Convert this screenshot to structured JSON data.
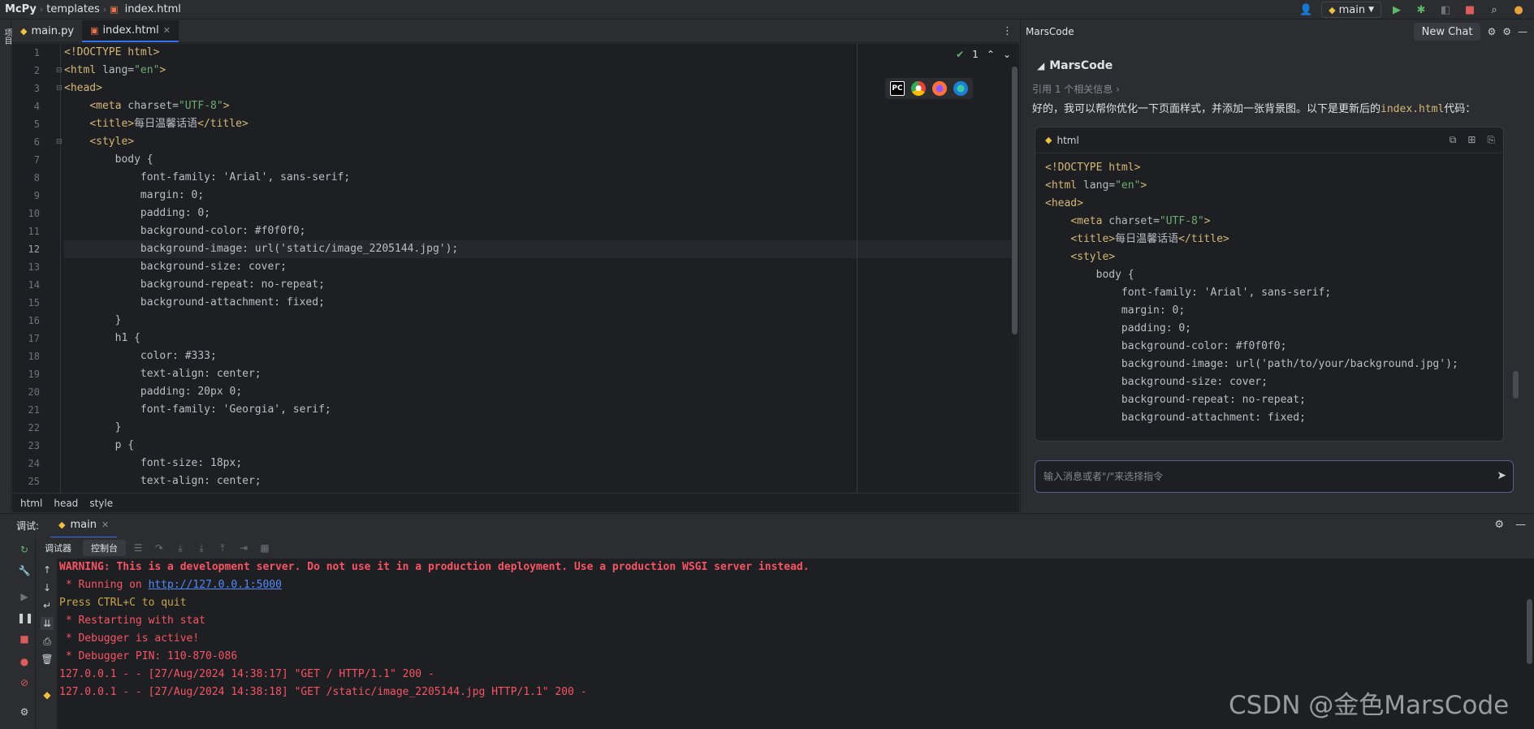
{
  "titlebar": {
    "project": "McPy",
    "folder": "templates",
    "file": "index.html",
    "branch": "main"
  },
  "left_stripe_label": "项目",
  "tabs": [
    {
      "label": "main.py",
      "icon": "python-file-icon"
    },
    {
      "label": "index.html",
      "icon": "html-file-icon"
    }
  ],
  "editor": {
    "current_line": 12,
    "inspection_count": "1",
    "lines": [
      [
        {
          "c": "tag",
          "t": "<!DOCTYPE "
        },
        {
          "c": "tag",
          "t": "html"
        },
        {
          "c": "tag",
          "t": ">"
        }
      ],
      [
        {
          "c": "tag",
          "t": "<html "
        },
        {
          "c": "attr",
          "t": "lang="
        },
        {
          "c": "str",
          "t": "\"en\""
        },
        {
          "c": "tag",
          "t": ">"
        }
      ],
      [
        {
          "c": "tag",
          "t": "<head>"
        }
      ],
      [
        {
          "c": "txt",
          "t": "    "
        },
        {
          "c": "tag",
          "t": "<meta "
        },
        {
          "c": "attr",
          "t": "charset="
        },
        {
          "c": "str",
          "t": "\"UTF-8\""
        },
        {
          "c": "tag",
          "t": ">"
        }
      ],
      [
        {
          "c": "txt",
          "t": "    "
        },
        {
          "c": "tag",
          "t": "<title>"
        },
        {
          "c": "txt",
          "t": "每日温馨话语"
        },
        {
          "c": "tag",
          "t": "</title>"
        }
      ],
      [
        {
          "c": "txt",
          "t": "    "
        },
        {
          "c": "tag",
          "t": "<style>"
        }
      ],
      [
        {
          "c": "sel",
          "t": "        body {"
        }
      ],
      [
        {
          "c": "prop",
          "t": "            font-family: 'Arial', sans-serif;"
        }
      ],
      [
        {
          "c": "prop",
          "t": "            margin: 0;"
        }
      ],
      [
        {
          "c": "prop",
          "t": "            padding: 0;"
        }
      ],
      [
        {
          "c": "prop",
          "t": "            background-color: #f0f0f0;"
        }
      ],
      [
        {
          "c": "prop",
          "t": "            background-image: url('static/image_2205144.jpg');"
        }
      ],
      [
        {
          "c": "prop",
          "t": "            background-size: cover;"
        }
      ],
      [
        {
          "c": "prop",
          "t": "            background-repeat: no-repeat;"
        }
      ],
      [
        {
          "c": "prop",
          "t": "            background-attachment: fixed;"
        }
      ],
      [
        {
          "c": "sel",
          "t": "        }"
        }
      ],
      [
        {
          "c": "sel",
          "t": "        h1 {"
        }
      ],
      [
        {
          "c": "prop",
          "t": "            color: #333;"
        }
      ],
      [
        {
          "c": "prop",
          "t": "            text-align: center;"
        }
      ],
      [
        {
          "c": "prop",
          "t": "            padding: 20px 0;"
        }
      ],
      [
        {
          "c": "prop",
          "t": "            font-family: 'Georgia', serif;"
        }
      ],
      [
        {
          "c": "sel",
          "t": "        }"
        }
      ],
      [
        {
          "c": "sel",
          "t": "        p {"
        }
      ],
      [
        {
          "c": "prop",
          "t": "            font-size: 18px;"
        }
      ],
      [
        {
          "c": "prop",
          "t": "            text-align: center;"
        }
      ]
    ]
  },
  "breadcrumbs": [
    "html",
    "head",
    "style"
  ],
  "marscode": {
    "panel_title": "MarsCode",
    "new_chat": "New Chat",
    "assistant_name": "MarsCode",
    "reference": "引用 1 个相关信息 ›",
    "message_prefix": "好的，我可以帮你优化一下页面样式，并添加一张背景图。以下是更新后的",
    "message_file": "index.html",
    "message_suffix": "代码：",
    "code_lang": "html",
    "code_lines": [
      [
        {
          "c": "tag",
          "t": "<!DOCTYPE html>"
        }
      ],
      [
        {
          "c": "tag",
          "t": "<html "
        },
        {
          "c": "attr",
          "t": "lang="
        },
        {
          "c": "str",
          "t": "\"en\""
        },
        {
          "c": "tag",
          "t": ">"
        }
      ],
      [
        {
          "c": "tag",
          "t": "<head>"
        }
      ],
      [
        {
          "c": "txt",
          "t": "    "
        },
        {
          "c": "tag",
          "t": "<meta "
        },
        {
          "c": "attr",
          "t": "charset="
        },
        {
          "c": "str",
          "t": "\"UTF-8\""
        },
        {
          "c": "tag",
          "t": ">"
        }
      ],
      [
        {
          "c": "txt",
          "t": "    "
        },
        {
          "c": "tag",
          "t": "<title>"
        },
        {
          "c": "txt",
          "t": "每日温馨话语"
        },
        {
          "c": "tag",
          "t": "</title>"
        }
      ],
      [
        {
          "c": "txt",
          "t": "    "
        },
        {
          "c": "tag",
          "t": "<style>"
        }
      ],
      [
        {
          "c": "sel",
          "t": "        body {"
        }
      ],
      [
        {
          "c": "prop",
          "t": "            font-family: 'Arial', sans-serif;"
        }
      ],
      [
        {
          "c": "prop",
          "t": "            margin: 0;"
        }
      ],
      [
        {
          "c": "prop",
          "t": "            padding: 0;"
        }
      ],
      [
        {
          "c": "prop",
          "t": "            background-color: #f0f0f0;"
        }
      ],
      [
        {
          "c": "prop",
          "t": "            background-image: url('path/to/your/background.jpg');"
        }
      ],
      [
        {
          "c": "prop",
          "t": "            background-size: cover;"
        }
      ],
      [
        {
          "c": "prop",
          "t": "            background-repeat: no-repeat;"
        }
      ],
      [
        {
          "c": "prop",
          "t": "            background-attachment: fixed;"
        }
      ]
    ],
    "input_placeholder": "输入消息或者\"/\"来选择指令"
  },
  "debug": {
    "label": "调试:",
    "run_config": "main",
    "subtabs": [
      "调试器",
      "控制台"
    ],
    "console_lines": [
      {
        "c": "warnb",
        "t": "WARNING: This is a development server. Do not use it in a production deployment. Use a production WSGI server instead."
      },
      {
        "c": "err",
        "t": " * Running on ",
        "link": "http://127.0.0.1:5000"
      },
      {
        "c": "ok",
        "t": "Press CTRL+C to quit"
      },
      {
        "c": "err",
        "t": " * Restarting with stat"
      },
      {
        "c": "err",
        "t": " * Debugger is active!"
      },
      {
        "c": "err",
        "t": " * Debugger PIN: 110-870-086"
      },
      {
        "c": "err",
        "t": "127.0.0.1 - - [27/Aug/2024 14:38:17] \"GET / HTTP/1.1\" 200 -"
      },
      {
        "c": "err",
        "t": "127.0.0.1 - - [27/Aug/2024 14:38:18] \"GET /static/image_2205144.jpg HTTP/1.1\" 200 -"
      }
    ]
  },
  "watermark": "CSDN @金色MarsCode",
  "colors": {
    "accent": "#3574f0",
    "tag": "#d5b778",
    "string": "#6aab73",
    "error": "#f75464",
    "link": "#548af7"
  }
}
